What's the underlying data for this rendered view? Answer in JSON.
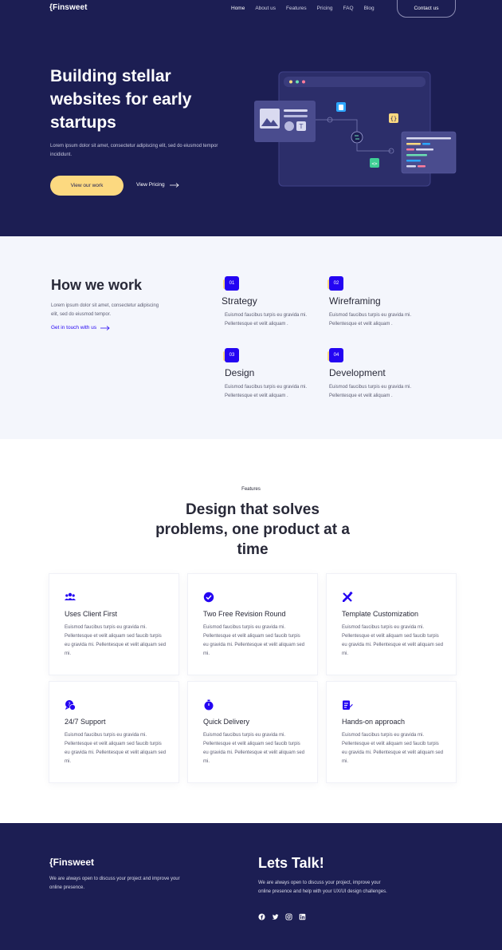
{
  "nav": {
    "logo": "{Finsweet",
    "links": [
      "Home",
      "About us",
      "Features",
      "Pricing",
      "FAQ",
      "Blog"
    ],
    "contact": "Contact us"
  },
  "hero": {
    "title": "Building stellar websites for early startups",
    "desc": "Lorem ipsum dolor sit amet, consectetur adipiscing elit, sed do eiusmod tempor incididunt.",
    "primary_btn": "View our work",
    "secondary_btn": "View Pricing"
  },
  "how": {
    "title": "How we work",
    "desc": "Lorem ipsum dolor sit amet, consectetur adipiscing elit, sed do eiusmod tempor.",
    "link": "Get in touch with us",
    "steps": [
      {
        "num": "01",
        "title": "Strategy",
        "desc": "Euismod faucibus turpis eu gravida mi. Pellentesque et velit aliquam ."
      },
      {
        "num": "02",
        "title": "Wireframing",
        "desc": "Euismod faucibus turpis eu gravida mi. Pellentesque et velit aliquam ."
      },
      {
        "num": "03",
        "title": "Design",
        "desc": "Euismod faucibus turpis eu gravida mi. Pellentesque et velit aliquam ."
      },
      {
        "num": "04",
        "title": "Development",
        "desc": "Euismod faucibus turpis eu gravida mi. Pellentesque et velit aliquam ."
      }
    ]
  },
  "features": {
    "eyebrow": "Features",
    "title": "Design that solves problems, one product at a time",
    "cards": [
      {
        "icon": "users-icon",
        "title": "Uses Client First",
        "desc": "Euismod faucibus turpis eu gravida mi. Pellentesque et velit aliquam sed faucib turpis eu gravida mi. Pellentesque et velit aliquam sed mi."
      },
      {
        "icon": "check-badge-icon",
        "title": "Two Free Revision Round",
        "desc": "Euismod faucibus turpis eu gravida mi. Pellentesque et velit aliquam sed faucib turpis eu gravida mi. Pellentesque et velit aliquam sed mi."
      },
      {
        "icon": "design-tools-icon",
        "title": "Template Customization",
        "desc": "Euismod faucibus turpis eu gravida mi. Pellentesque et velit aliquam sed faucib turpis eu gravida mi. Pellentesque et velit aliquam sed mi."
      },
      {
        "icon": "support-chat-icon",
        "title": "24/7 Support",
        "desc": "Euismod faucibus turpis eu gravida mi. Pellentesque et velit aliquam sed faucib turpis eu gravida mi. Pellentesque et velit aliquam sed mi."
      },
      {
        "icon": "stopwatch-icon",
        "title": "Quick Delivery",
        "desc": "Euismod faucibus turpis eu gravida mi. Pellentesque et velit aliquam sed faucib turpis eu gravida mi. Pellentesque et velit aliquam sed mi."
      },
      {
        "icon": "edit-doc-icon",
        "title": "Hands-on approach",
        "desc": "Euismod faucibus turpis eu gravida mi. Pellentesque et velit aliquam sed faucib turpis eu gravida mi. Pellentesque et velit aliquam sed mi."
      }
    ]
  },
  "footer": {
    "logo": "{Finsweet",
    "desc": "We are always open to discuss your project and improve your online presence.",
    "title": "Lets Talk!",
    "desc2": "We are always open to discuss your project, improve your online presence and help with your UX/UI design challenges.",
    "socials": [
      "facebook-icon",
      "twitter-icon",
      "instagram-icon",
      "linkedin-icon"
    ]
  },
  "colors": {
    "navy": "#1c1e53",
    "accent_yellow": "#fcd980",
    "accent_blue": "#2405f2",
    "light_bg": "#f4f6fc"
  }
}
